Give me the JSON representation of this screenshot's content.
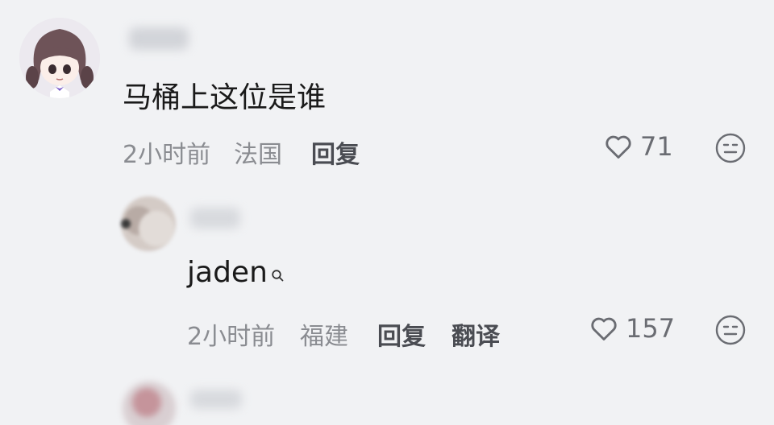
{
  "comments": [
    {
      "text": "马桶上这位是谁",
      "time": "2小时前",
      "location": "法国",
      "reply_label": "回复",
      "likes": "71",
      "like_icon": "heart-outline-icon",
      "dislike_icon": "neutral-face-icon"
    },
    {
      "text": "jaden",
      "search_icon": "search-icon",
      "time": "2小时前",
      "location": "福建",
      "reply_label": "回复",
      "translate_label": "翻译",
      "likes": "157",
      "like_icon": "heart-outline-icon",
      "dislike_icon": "neutral-face-icon"
    }
  ],
  "colors": {
    "background": "#f1f2f4",
    "text_primary": "#1a1a1a",
    "text_meta": "#8a8c91",
    "text_action": "#4a4c52"
  }
}
